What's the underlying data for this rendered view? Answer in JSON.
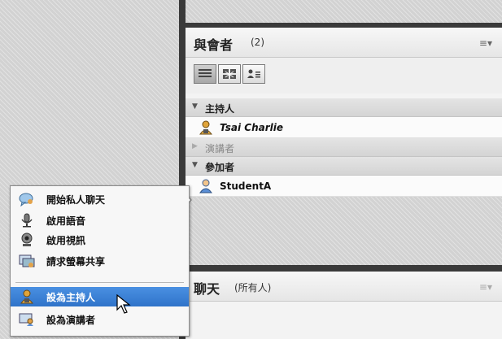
{
  "attendees_pod": {
    "title": "與會者",
    "count": "(2)",
    "menu_icon": "≡▾"
  },
  "groups": {
    "host": "主持人",
    "presenter": "演講者",
    "participant": "參加者"
  },
  "users": {
    "host_user": "Tsai Charlie",
    "participant_user": "StudentA"
  },
  "chat_pod": {
    "title": "聊天",
    "scope": "(所有人)",
    "menu_icon": "≡▾"
  },
  "context_menu": {
    "items": [
      {
        "label": "開始私人聊天",
        "icon": "chat-bubble-icon"
      },
      {
        "label": "啟用語音",
        "icon": "microphone-icon"
      },
      {
        "label": "啟用視訊",
        "icon": "webcam-icon"
      },
      {
        "label": "請求螢幕共享",
        "icon": "screen-share-icon"
      },
      {
        "label": "設為主持人",
        "icon": "host-user-icon",
        "selected": true
      },
      {
        "label": "設為演講者",
        "icon": "presenter-icon"
      }
    ]
  },
  "colors": {
    "menu_selected": "#3a7fd6",
    "pod_background": "#f3f3f3",
    "dark_frame": "#3a3a3a"
  }
}
